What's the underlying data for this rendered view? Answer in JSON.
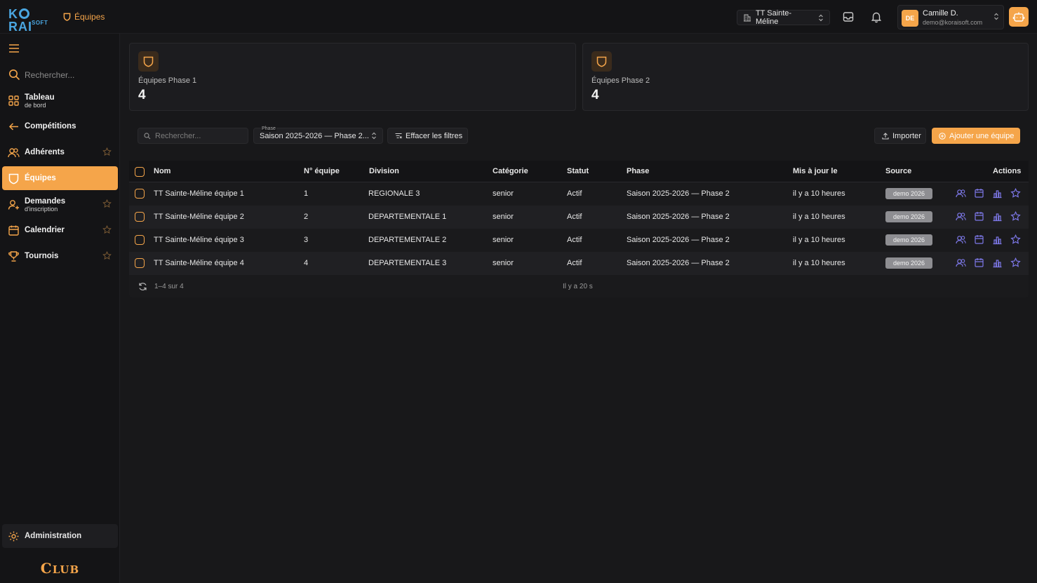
{
  "header": {
    "logo_main_pre": "K",
    "logo_main_post": "RAI",
    "logo_sub": "SOFT",
    "breadcrumb": "Équipes",
    "club_selector": "TT Sainte-Méline",
    "user": {
      "initials": "DE",
      "name": "Camille D.",
      "email": "demo@koraisoft.com"
    }
  },
  "sidebar": {
    "search_placeholder": "Rechercher...",
    "items": [
      {
        "label": "Tableau",
        "sublabel": "de bord",
        "icon": "dashboard-icon"
      },
      {
        "label": "Compétitions",
        "icon": "arrow-left-icon"
      },
      {
        "label": "Adhérents",
        "icon": "users-icon",
        "favorite": true
      },
      {
        "label": "Équipes",
        "icon": "shield-icon",
        "active": true
      },
      {
        "label": "Demandes",
        "sublabel": "d'inscription",
        "icon": "user-add-icon",
        "favorite": true
      },
      {
        "label": "Calendrier",
        "icon": "calendar-icon",
        "favorite": true
      },
      {
        "label": "Tournois",
        "icon": "trophy-icon",
        "favorite": true
      }
    ],
    "admin_label": "Administration",
    "footer_label_big": "C",
    "footer_label_small": "LUB"
  },
  "stats": [
    {
      "label": "Équipes Phase 1",
      "value": "4"
    },
    {
      "label": "Équipes Phase 2",
      "value": "4"
    }
  ],
  "toolbar": {
    "search_placeholder": "Rechercher...",
    "phase_label": "Phase",
    "phase_value": "Saison 2025-2026 — Phase 2...",
    "clear_filters": "Effacer les filtres",
    "import": "Importer",
    "add_team": "Ajouter une équipe"
  },
  "table": {
    "columns": [
      "Nom",
      "N° équipe",
      "Division",
      "Catégorie",
      "Statut",
      "Phase",
      "Mis à jour le",
      "Source",
      "Actions"
    ],
    "rows": [
      {
        "nom": "TT Sainte-Méline équipe 1",
        "numero": "1",
        "division": "REGIONALE 3",
        "categorie": "senior",
        "statut": "Actif",
        "phase": "Saison 2025-2026 — Phase 2",
        "maj": "il y a 10 heures",
        "source": "demo 2026"
      },
      {
        "nom": "TT Sainte-Méline équipe 2",
        "numero": "2",
        "division": "DEPARTEMENTALE 1",
        "categorie": "senior",
        "statut": "Actif",
        "phase": "Saison 2025-2026 — Phase 2",
        "maj": "il y a 10 heures",
        "source": "demo 2026"
      },
      {
        "nom": "TT Sainte-Méline équipe 3",
        "numero": "3",
        "division": "DEPARTEMENTALE 2",
        "categorie": "senior",
        "statut": "Actif",
        "phase": "Saison 2025-2026 — Phase 2",
        "maj": "il y a 10 heures",
        "source": "demo 2026"
      },
      {
        "nom": "TT Sainte-Méline équipe 4",
        "numero": "4",
        "division": "DEPARTEMENTALE 3",
        "categorie": "senior",
        "statut": "Actif",
        "phase": "Saison 2025-2026 — Phase 2",
        "maj": "il y a 10 heures",
        "source": "demo 2026"
      }
    ],
    "footer_count": "1–4 sur 4",
    "footer_updated": "Il y a 20 s"
  },
  "colors": {
    "accent": "#f5a54a",
    "action_icons": "#7d78e8",
    "logo": "#4aa6e0"
  }
}
